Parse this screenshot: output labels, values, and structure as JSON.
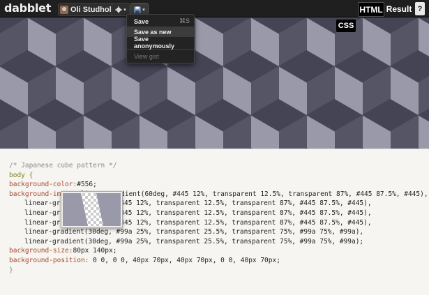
{
  "app": {
    "logo": "dabblet",
    "user": "Oli Studholme"
  },
  "toolbar": {
    "gear_icon": "gear-icon",
    "save_icon": "floppy-disk-icon"
  },
  "tabs": {
    "html": "HTML",
    "result": "Result",
    "help": "?"
  },
  "css_badge": "CSS",
  "save_menu": {
    "items": [
      {
        "label": "Save",
        "shortcut": "⌘S"
      },
      {
        "label": "Save as new"
      },
      {
        "label": "Save anonymously"
      },
      {
        "label": "View gist"
      }
    ]
  },
  "code": {
    "lines": [
      {
        "text": "/* Japanese cube pattern */"
      },
      {
        "text": "body {"
      },
      {
        "prop": "background-color:",
        "value": "#556;"
      },
      {
        "prop": "background-image:",
        "value": " linear-gradient(60deg, #445 12%, transparent 12.5%, transparent 87%, #445 87.5%, #445),"
      },
      {
        "text": "linear-gradient(30deg, #445 12%, transparent 12.5%, transparent 87%, #445 87.5%, #445),"
      },
      {
        "text": "linear-gradient(60deg, #445 12%, transparent 12.5%, transparent 87%, #445 87.5%, #445),"
      },
      {
        "text": "linear-gradient(30deg, #445 12%, transparent 12.5%, transparent 87%, #445 87.5%, #445),"
      },
      {
        "text": "linear-gradient(30deg, #99a 25%, transparent 25.5%, transparent 75%, #99a 75%, #99a),"
      },
      {
        "text": "linear-gradient(30deg, #99a 25%, transparent 25.5%, transparent 75%, #99a 75%, #99a);"
      },
      {
        "prop": "background-size:",
        "value": "80px 140px;"
      },
      {
        "prop": "background-position:",
        "value": " 0 0, 0 0, 40px 70px, 40px 70px, 0 0, 40px 70px;"
      },
      {
        "text": "}"
      }
    ]
  },
  "colors": {
    "topbar": "#1f1f1f",
    "editor_bg": "#f6f5f1",
    "pattern_dark": "#445",
    "pattern_light": "#99a",
    "pattern_base": "#556"
  }
}
